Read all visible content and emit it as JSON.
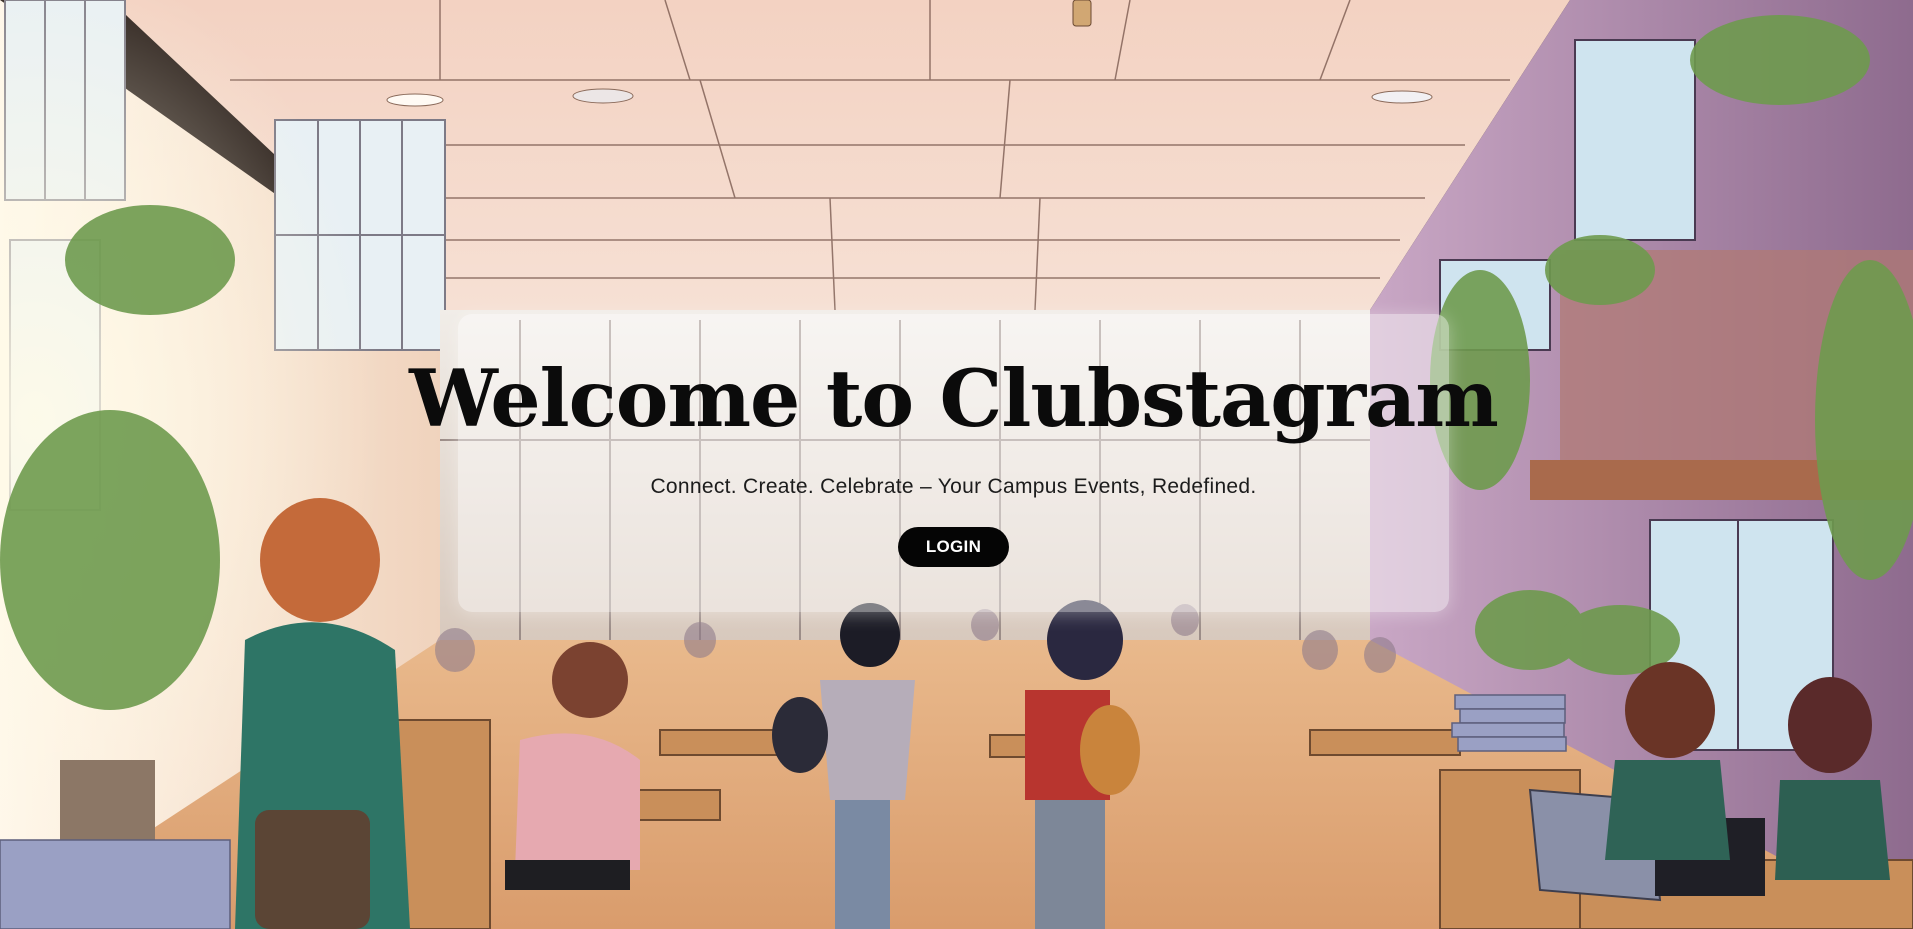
{
  "hero": {
    "title": "Welcome to Clubstagram",
    "tagline": "Connect. Create. Celebrate – Your Campus Events, Redefined.",
    "login_label": "LOGIN"
  },
  "colors": {
    "button_bg": "#050505",
    "button_text": "#ffffff",
    "title_text": "#0b0b0b",
    "card_bg": "rgba(255,255,255,0.45)"
  }
}
